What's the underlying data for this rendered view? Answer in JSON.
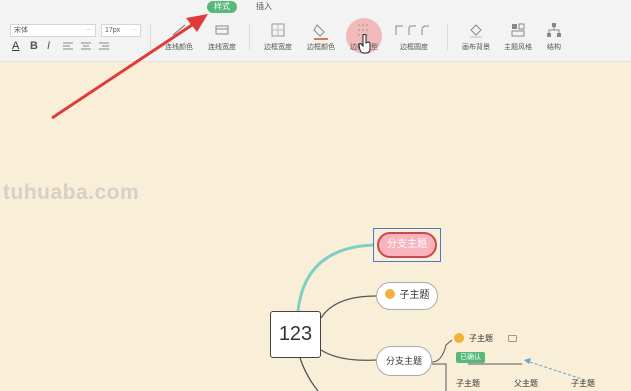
{
  "tabs": {
    "style": "样式",
    "insert": "插入"
  },
  "font": {
    "name": "宋体",
    "size": "17px",
    "arrow": "···"
  },
  "format": {
    "a": "A",
    "b": "B",
    "i": "I"
  },
  "tools": {
    "line_color": "连线颜色",
    "line_width": "连线宽度",
    "border_width": "边框宽度",
    "border_color": "边框颜色",
    "border_type": "边框类型",
    "border_radius": "边框圆度",
    "canvas_bg": "画布背景",
    "theme_style": "主题风格",
    "structure": "结构"
  },
  "watermark": "tuhuaba.com",
  "mindmap": {
    "root": "123",
    "branch_selected": "分支主题",
    "sub_topic_1": "子主题",
    "branch_2": "分支主题",
    "sub_topic_2": "子主题",
    "badge": "已确认",
    "leaf_1": "子主题",
    "leaf_2": "父主题",
    "leaf_3": "子主题"
  },
  "colors": {
    "accent": "#57b87a",
    "canvas": "#f9efd9",
    "arrow": "#e03a3a",
    "teal_link": "#7fd0c4",
    "selection": "#4a79c9"
  }
}
